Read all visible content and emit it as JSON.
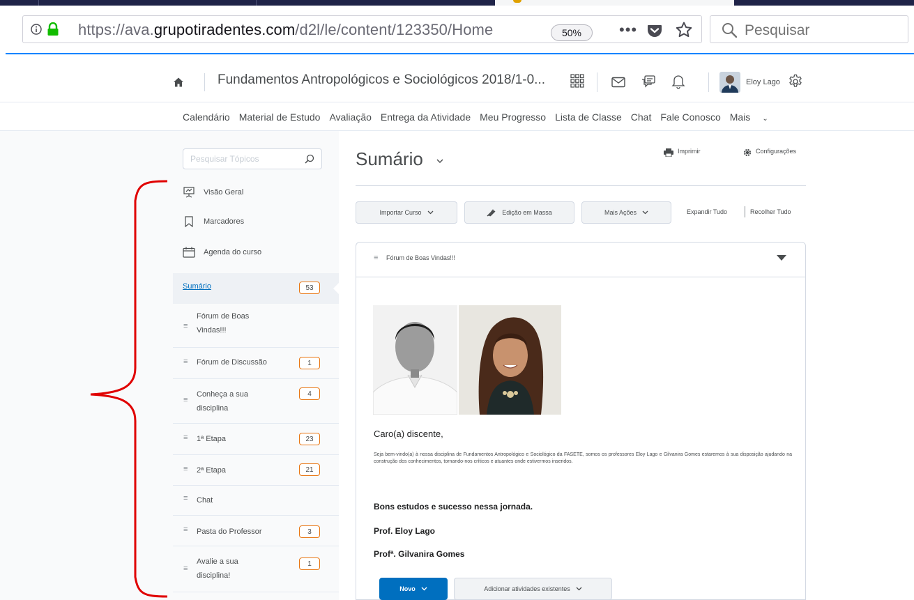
{
  "browser": {
    "url_prefix": "https://ava.",
    "url_host": "grupotiradentes.com",
    "url_path": "/d2l/le/content/123350/Home",
    "zoom": "50%",
    "more_glyph": "•••",
    "search_placeholder": "Pesquisar",
    "icons": [
      "info-icon",
      "lock-icon",
      "pocket-icon",
      "star-icon",
      "search-icon"
    ],
    "accent_color": "#0a84ff"
  },
  "header": {
    "course_title": "Fundamentos Antropológicos e Sociológicos 2018/1-0...",
    "user_name": "Eloy Lago",
    "icons": [
      "home-icon",
      "apps-grid-icon",
      "mail-icon",
      "chat-icon",
      "bell-icon",
      "gear-icon"
    ]
  },
  "nav": {
    "links": [
      "Calendário",
      "Material de Estudo",
      "Avaliação",
      "Entrega da Atividade",
      "Meu Progresso",
      "Lista de Classe",
      "Chat",
      "Fale Conosco",
      "Mais"
    ]
  },
  "sidebar": {
    "search_placeholder": "Pesquisar Tópicos",
    "tools": [
      {
        "label": "Visão Geral",
        "icon": "overview-icon"
      },
      {
        "label": "Marcadores",
        "icon": "bookmark-icon"
      },
      {
        "label": "Agenda do curso",
        "icon": "calendar-icon"
      }
    ],
    "toc_root": {
      "label": "Sumário",
      "count": "53"
    },
    "toc_items": [
      {
        "label": "Fórum de Boas Vindas!!!",
        "count": ""
      },
      {
        "label": "Fórum de Discussão",
        "count": "1"
      },
      {
        "label": "Conheça a sua disciplina",
        "count": "4"
      },
      {
        "label": "1ª Etapa",
        "count": "23"
      },
      {
        "label": "2ª Etapa",
        "count": "21"
      },
      {
        "label": "Chat",
        "count": ""
      },
      {
        "label": "Pasta do Professor",
        "count": "3"
      },
      {
        "label": "Avalie a sua disciplina!",
        "count": "1"
      }
    ],
    "badge_color": "#e87511",
    "annotation_color": "#e00000"
  },
  "main": {
    "title": "Sumário",
    "print_label": "Imprimir",
    "settings_label": "Configurações",
    "import_label": "Importar Curso",
    "bulk_edit_label": "Edição em Massa",
    "more_actions_label": "Mais Ações",
    "expand_all": "Expandir Tudo",
    "collapse_all": "Recolher Tudo",
    "module": {
      "title": "Fórum de Boas Vindas!!!",
      "greeting": "Caro(a) discente,",
      "welcome_text": "Seja bem-vindo(a) à nossa disciplina de Fundamentos Antropológico e Sociológico da FASETE, somos os professores Eloy Lago e Gilvanira Gomes estaremos à sua disposição ajudando na construção dos conhecimentos, tornando-nos críticos e atuantes onde estivermos inseridos.",
      "closing": "Bons estudos e sucesso nessa jornada.",
      "signature_1": "Prof. Eloy Lago",
      "signature_2": "Profª. Gilvanira Gomes"
    },
    "new_label": "Novo",
    "add_existing_label": "Adicionar atividades existentes",
    "primary_color": "#006fbf"
  }
}
